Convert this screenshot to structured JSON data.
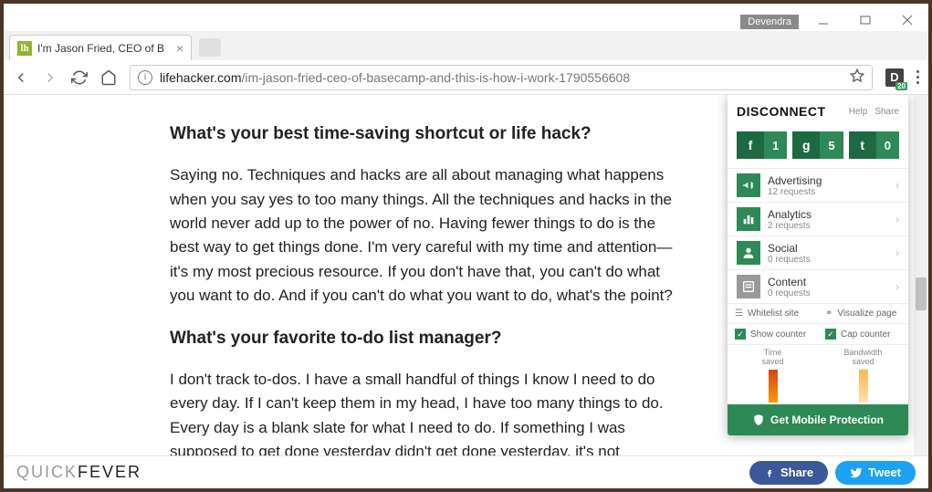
{
  "window": {
    "profile": "Devendra"
  },
  "tab": {
    "favicon": "lh",
    "title": "I'm Jason Fried, CEO of B"
  },
  "url": {
    "host": "lifehacker.com",
    "path": "/im-jason-fried-ceo-of-basecamp-and-this-is-how-i-work-1790556608"
  },
  "extension": {
    "letter": "D",
    "badge": "20"
  },
  "article": {
    "h1": "What's your best time-saving shortcut or life hack?",
    "p1": "Saying no. Techniques and hacks are all about managing what happens when you say yes to too many things. All the techniques and hacks in the world never add up to the power of no. Having fewer things to do is the best way to get things done. I'm very careful with my time and attention—it's my most precious resource. If you don't have that, you can't do what you want to do. And if you can't do what you want to do, what's the point?",
    "h2": "What's your favorite to-do list manager?",
    "p2": "I don't track to-dos. I have a small handful of things I know I need to do every day. If I can't keep them in my head, I have too many things to do. Every day is a blank slate for what I need to do. If something I was supposed to get done yesterday didn't get done yesterday, it's not automatically on my mind for"
  },
  "footer": {
    "logo1": "QUICK",
    "logo2": "FEVER",
    "share": "Share",
    "tweet": "Tweet"
  },
  "panel": {
    "brand": "DISCONNECT",
    "help": "Help",
    "share": "Share",
    "social": [
      {
        "icon": "f",
        "count": "1"
      },
      {
        "icon": "g",
        "count": "5"
      },
      {
        "icon": "t",
        "count": "0"
      }
    ],
    "categories": [
      {
        "name": "Advertising",
        "req": "12 requests",
        "on": true
      },
      {
        "name": "Analytics",
        "req": "2 requests",
        "on": true
      },
      {
        "name": "Social",
        "req": "0 requests",
        "on": true
      },
      {
        "name": "Content",
        "req": "0 requests",
        "on": false
      }
    ],
    "whitelist": "Whitelist site",
    "visualize": "Visualize page",
    "showcounter": "Show counter",
    "capcounter": "Cap counter",
    "graph1a": "Time",
    "graph1b": "saved",
    "graph2a": "Bandwidth",
    "graph2b": "saved",
    "mobile": "Get Mobile Protection"
  }
}
